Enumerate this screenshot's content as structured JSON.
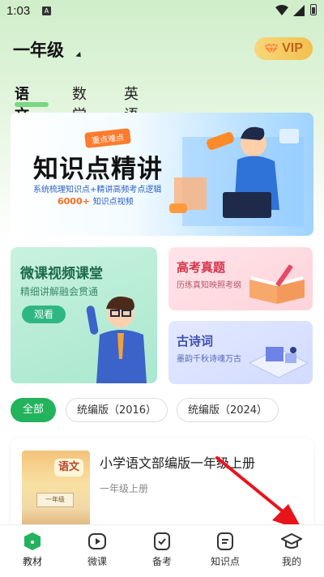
{
  "status_bar": {
    "time": "1:03",
    "notification_letter": "A"
  },
  "header": {
    "grade": "一年级",
    "vip_label": "VIP"
  },
  "subject_tabs": [
    {
      "label": "语文",
      "active": true
    },
    {
      "label": "数学",
      "active": false
    },
    {
      "label": "英语",
      "active": false
    }
  ],
  "banner": {
    "tag": "重点难点",
    "title": "知识点精讲",
    "subtitle": "系统梳理知识点+精讲高频考点逻辑",
    "count": "6000+",
    "count_suffix": "知识点视频"
  },
  "cards": {
    "micro": {
      "title": "微课视频课堂",
      "subtitle": "精细讲解融会贯通",
      "button": "观看"
    },
    "exam": {
      "title": "高考真题",
      "subtitle": "历练真知映照考纲"
    },
    "poem": {
      "title": "古诗词",
      "subtitle": "墨韵千秋诗魂万古"
    }
  },
  "filters": [
    {
      "label": "全部",
      "active": true
    },
    {
      "label": "统编版（2016）",
      "active": false
    },
    {
      "label": "统编版（2024）",
      "active": false
    }
  ],
  "book": {
    "title": "小学语文部编版一年级上册",
    "grade": "一年级上册",
    "cover_title": "语文",
    "cover_grade": "一年级"
  },
  "tabbar": [
    {
      "label": "教材",
      "icon": "textbook-icon",
      "active": true
    },
    {
      "label": "微课",
      "icon": "video-icon",
      "active": false
    },
    {
      "label": "备考",
      "icon": "exam-prep-icon",
      "active": false
    },
    {
      "label": "知识点",
      "icon": "knowledge-icon",
      "active": false
    },
    {
      "label": "我的",
      "icon": "graduation-cap-icon",
      "active": false
    }
  ],
  "colors": {
    "accent_green": "#22b35c",
    "arrow_red": "#e8141b"
  }
}
